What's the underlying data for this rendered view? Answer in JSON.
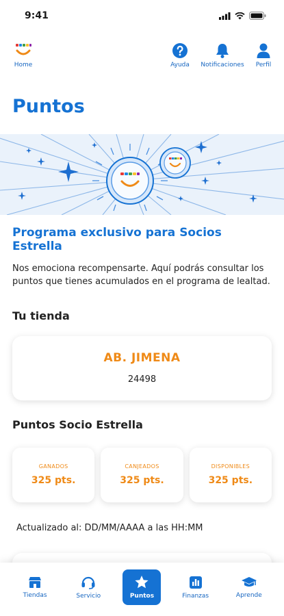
{
  "status": {
    "time": "9:41"
  },
  "topnav": {
    "home_label": "Home",
    "items": [
      {
        "label": "Ayuda",
        "icon": "help-icon"
      },
      {
        "label": "Notificaciones",
        "icon": "bell-icon"
      },
      {
        "label": "Perfil",
        "icon": "user-icon"
      }
    ]
  },
  "page": {
    "title": "Puntos"
  },
  "program": {
    "title": "Programa exclusivo para Socios Estrella",
    "description": "Nos emociona recompensarte. Aquí podrás consultar los puntos que tienes acumulados en el programa de lealtad."
  },
  "store": {
    "section_title": "Tu tienda",
    "name": "AB. JIMENA",
    "id": "24498"
  },
  "points": {
    "section_title": "Puntos Socio Estrella",
    "cards": [
      {
        "label": "GANADOS",
        "value": "325 pts."
      },
      {
        "label": "CANJEADOS",
        "value": "325 pts."
      },
      {
        "label": "DISPONIBLES",
        "value": "325 pts."
      }
    ],
    "updated": "Actualizado al: DD/MM/AAAA a las HH:MM"
  },
  "tabs": [
    {
      "label": "Tiendas",
      "icon": "store-icon"
    },
    {
      "label": "Servicio",
      "icon": "headset-icon"
    },
    {
      "label": "Puntos",
      "icon": "star-icon",
      "active": true
    },
    {
      "label": "Finanzas",
      "icon": "chart-icon"
    },
    {
      "label": "Aprende",
      "icon": "graduation-cap-icon"
    }
  ],
  "colors": {
    "brand_blue": "#1572d3",
    "accent_orange": "#ef8a17",
    "banner_bg": "#eaf2fb"
  }
}
